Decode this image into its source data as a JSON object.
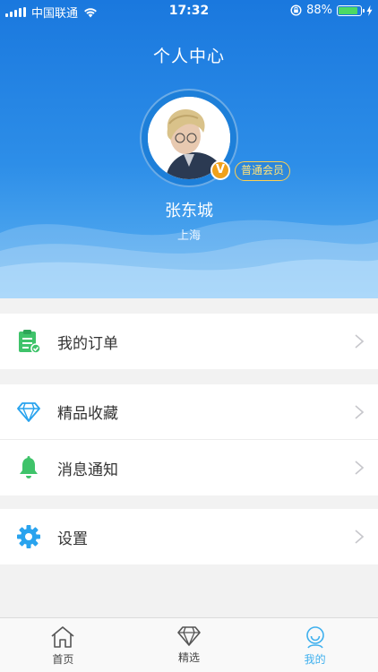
{
  "status_bar": {
    "carrier": "中国联通",
    "time": "17:32",
    "battery": "88%",
    "battery_level": 0.88
  },
  "header": {
    "title": "个人中心",
    "user_name": "张东城",
    "city": "上海",
    "vip_letter": "V",
    "member_level": "普通会员"
  },
  "menu": {
    "orders": {
      "label": "我的订单",
      "icon": "clipboard-check-icon"
    },
    "favorites": {
      "label": "精品收藏",
      "icon": "diamond-icon"
    },
    "notifications": {
      "label": "消息通知",
      "icon": "bell-icon"
    },
    "settings": {
      "label": "设置",
      "icon": "gear-icon"
    }
  },
  "tabbar": {
    "items": [
      {
        "label": "首页",
        "icon": "home-icon"
      },
      {
        "label": "精选",
        "icon": "diamond-icon"
      },
      {
        "label": "我的",
        "icon": "profile-icon"
      }
    ],
    "active": "我的"
  },
  "colors": {
    "header_blue": "#1a78de",
    "green_icon": "#3fc36a",
    "blue_icon": "#29a3ee",
    "active_tab": "#3fb0ee",
    "member_gold": "#ffd04d"
  }
}
